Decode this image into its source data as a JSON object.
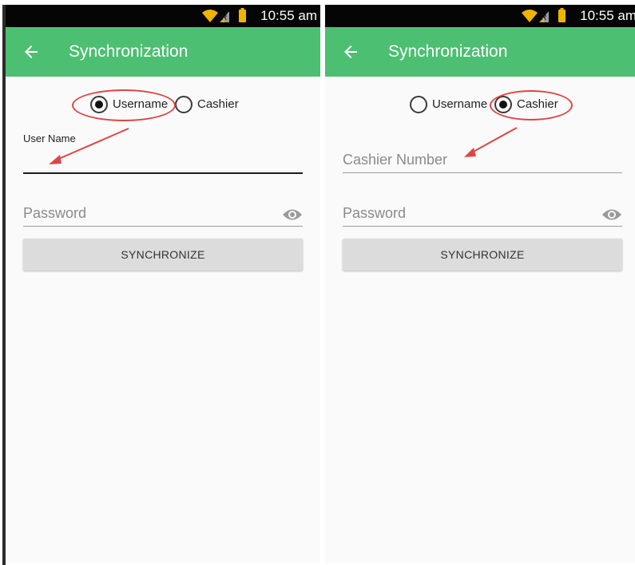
{
  "colors": {
    "status_bar": "#050505",
    "app_bar": "#4cbf72",
    "background": "#fafafa",
    "annotation": "#e04545",
    "button": "#dcdcdc",
    "status_icons": "#f0b400"
  },
  "screens": [
    {
      "status": {
        "time": "10:55 am",
        "icons": [
          "wifi-icon",
          "signal-icon",
          "battery-icon"
        ]
      },
      "app_bar": {
        "title": "Synchronization",
        "back_icon": "arrow-left-icon"
      },
      "radio": {
        "options": [
          {
            "label": "Username",
            "checked": true
          },
          {
            "label": "Cashier",
            "checked": false
          }
        ]
      },
      "login_field": {
        "label": "User Name",
        "value": ""
      },
      "password_field": {
        "placeholder": "Password",
        "icon": "eye-icon"
      },
      "button": {
        "label": "SYNCHRONIZE"
      }
    },
    {
      "status": {
        "time": "10:55 am",
        "icons": [
          "wifi-icon",
          "signal-icon",
          "battery-icon"
        ]
      },
      "app_bar": {
        "title": "Synchronization",
        "back_icon": "arrow-left-icon"
      },
      "radio": {
        "options": [
          {
            "label": "Username",
            "checked": false
          },
          {
            "label": "Cashier",
            "checked": true
          }
        ]
      },
      "login_field": {
        "placeholder": "Cashier Number",
        "value": ""
      },
      "password_field": {
        "placeholder": "Password",
        "icon": "eye-icon"
      },
      "button": {
        "label": "SYNCHRONIZE"
      }
    }
  ]
}
